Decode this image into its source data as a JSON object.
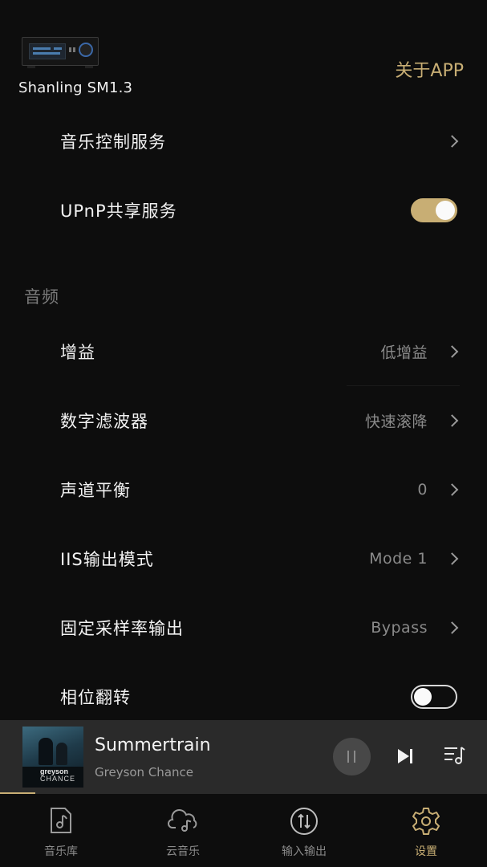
{
  "header": {
    "device_name": "Shanling SM1.3",
    "about_label": "关于APP"
  },
  "network": [
    {
      "label": "音乐控制服务",
      "type": "link"
    },
    {
      "label": "UPnP共享服务",
      "type": "toggle",
      "on": true
    }
  ],
  "audio": {
    "section_title": "音频",
    "items": [
      {
        "label": "增益",
        "value": "低增益"
      },
      {
        "label": "数字滤波器",
        "value": "快速滚降"
      },
      {
        "label": "声道平衡",
        "value": "0"
      },
      {
        "label": "IIS输出模式",
        "value": "Mode 1"
      },
      {
        "label": "固定采样率输出",
        "value": "Bypass"
      },
      {
        "label": "相位翻转",
        "type": "toggle",
        "on": false
      }
    ]
  },
  "now_playing": {
    "title": "Summertrain",
    "artist": "Greyson Chance",
    "album_text_1": "greyson",
    "album_text_2": "CHANCE",
    "state": "playing"
  },
  "tabs": [
    {
      "label": "音乐库",
      "icon": "music-file-icon",
      "active": false
    },
    {
      "label": "云音乐",
      "icon": "cloud-music-icon",
      "active": false
    },
    {
      "label": "输入输出",
      "icon": "input-output-icon",
      "active": false
    },
    {
      "label": "设置",
      "icon": "settings-gear-icon",
      "active": true
    }
  ],
  "colors": {
    "accent": "#c8ae74",
    "background": "#0d0d0d",
    "player_bg": "#2a2a2a"
  }
}
